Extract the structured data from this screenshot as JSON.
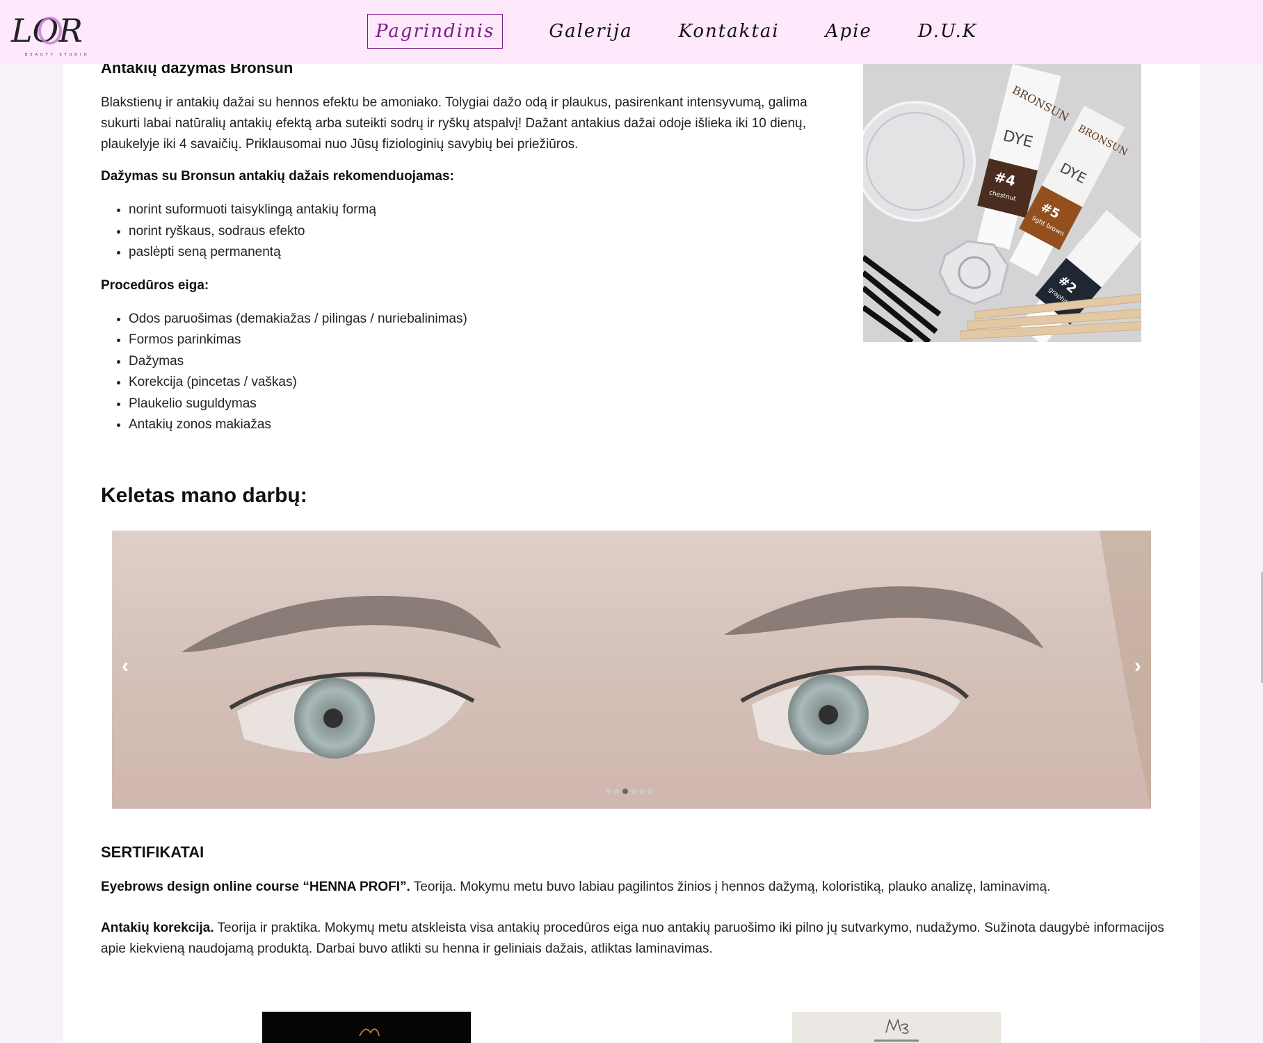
{
  "nav": {
    "logo_text": "LOR",
    "logo_sub": "BEAUTY STUDIO",
    "items": [
      {
        "label": "Pagrindinis",
        "active": true
      },
      {
        "label": "Galerija"
      },
      {
        "label": "Kontaktai"
      },
      {
        "label": "Apie"
      },
      {
        "label": "D.U.K"
      }
    ]
  },
  "section": {
    "title": "Antakių dažymas Bronsun",
    "description": "Blakstienų ir antakių dažai su hennos efektu be amoniako. Tolygiai dažo odą ir plaukus, pasirenkant intensyvumą, galima sukurti labai natūralių antakių efektą arba suteikti sodrų ir ryškų atspalvį! Dažant antakius dažai odoje išlieka iki 10 dienų, plaukelyje iki 4 savaičių. Priklausomai nuo Jūsų fiziologinių savybių bei priežiūros.",
    "recommended_heading": "Dažymas su Bronsun antakių dažais rekomenduojamas:",
    "recommended": [
      "norint suformuoti taisyklingą antakių formą",
      "norint ryškaus, sodraus efekto",
      "paslėpti seną permanentą"
    ],
    "procedure_heading": "Procedūros eiga:",
    "procedure": [
      "Odos paruošimas (demakiažas / pilingas / nuriebalinimas)",
      "Formos parinkimas",
      "Dažymas",
      "Korekcija (pincetas / vaškas)",
      "Plaukelio suguldymas",
      "Antakių zonos makiažas"
    ],
    "photo_tubes": [
      {
        "brand": "BRONSUN",
        "product": "Eyelash and eyebrow DYE",
        "number": "#4",
        "shade": "chestnut"
      },
      {
        "brand": "BRONSUN",
        "product": "Eyelash and eyebrow DYE",
        "number": "#5",
        "shade": "light brown"
      },
      {
        "number": "#2",
        "shade": "graphite"
      }
    ]
  },
  "works": {
    "title": "Keletas mano darbų:",
    "prev_label": "‹",
    "next_label": "›",
    "slide_count": 5,
    "active_slide": 2
  },
  "certificates": {
    "title": "SERTIFIKATAI",
    "items": [
      {
        "bold": "Eyebrows design online course “HENNA PROFI”.",
        "text": " Teorija. Mokymu metu buvo labiau pagilintos žinios į hennos dažymą, koloristiką, plauko analizę, laminavimą."
      },
      {
        "bold": "Antakių korekcija.",
        "text": " Teorija ir praktika. Mokymų metu atskleista visa antakių procedūros eiga nuo antakių paruošimo iki pilno jų sutvarkymo, nudažymo. Sužinota daugybė informacijos apie kiekvieną naudojamą produktą. Darbai buvo atlikti su henna ir geliniais dažais, atliktas laminavimas."
      }
    ]
  },
  "colors": {
    "nav_bg": "#fde8fc",
    "page_bg": "#f8f2fb",
    "accent": "#7b1d87"
  }
}
